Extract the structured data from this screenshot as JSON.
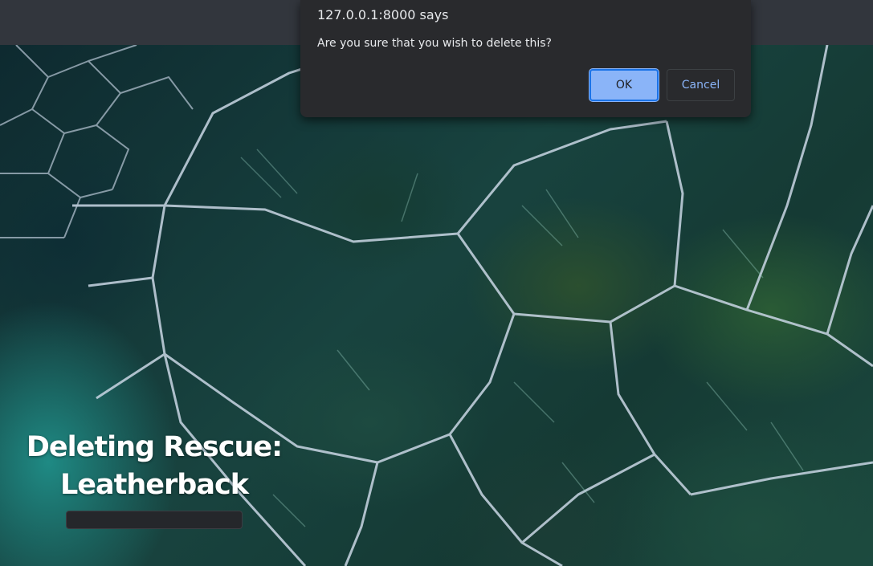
{
  "dialog": {
    "title": "127.0.0.1:8000 says",
    "message": "Are you sure that you wish to delete this?",
    "ok_label": "OK",
    "cancel_label": "Cancel"
  },
  "page": {
    "heading_line1": "Deleting Rescue:",
    "heading_line2": "Leatherback"
  },
  "colors": {
    "dialog_bg": "#292a2d",
    "ok_button": "#8ab4f8",
    "cancel_text": "#8ab4f8",
    "top_bar": "#32363d"
  }
}
